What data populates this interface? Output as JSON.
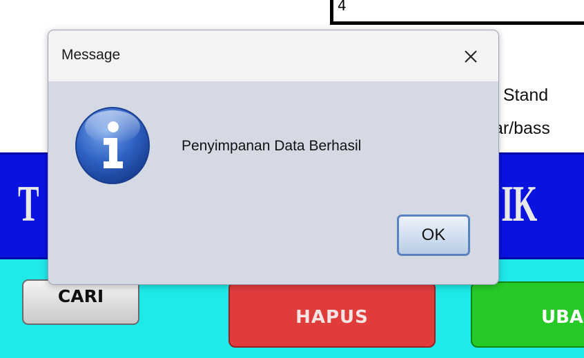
{
  "background_app": {
    "input_value": "4",
    "label_line_1": "n Stand",
    "label_line_2": "tar/bass",
    "title_left_fragment": "T",
    "title_right_fragment": "IK",
    "buttons": {
      "cari": "CARI",
      "hapus": "HAPUS",
      "ubah": "UBA"
    }
  },
  "dialog": {
    "title": "Message",
    "close_glyph": "✕",
    "icon": "info-icon",
    "message": "Penyimpanan Data Berhasil",
    "ok_label": "OK"
  },
  "colors": {
    "title_banner": "#0a12e0",
    "button_strip": "#1fe9e9",
    "hapus_button": "#e03c3c",
    "ubah_button": "#27c927",
    "dialog_body": "#d4d9e4",
    "ok_border": "#5a82c0"
  }
}
